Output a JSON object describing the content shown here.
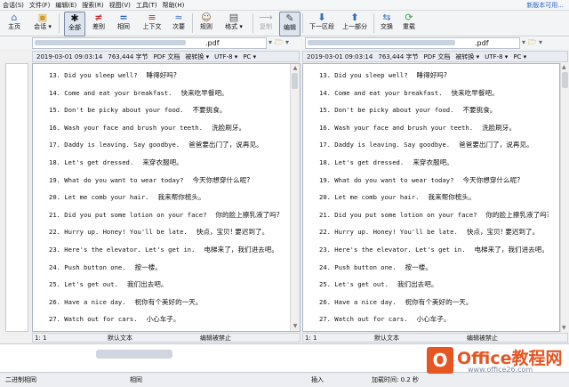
{
  "menu": [
    "会话(S)",
    "文件(F)",
    "编辑(E)",
    "搜索(R)",
    "视图(V)",
    "工具(T)",
    "帮助(H)"
  ],
  "menu_right": "新版本可用...",
  "toolbar": {
    "home": "主页",
    "session": "会话",
    "all": "全部",
    "diffs": "差别",
    "same": "相同",
    "context": "上下文",
    "minor": "次要",
    "rules": "规则",
    "format": "格式",
    "copy": "复制",
    "edit": "编辑",
    "next_section": "下一区段",
    "prev_section": "上一部分",
    "swap": "交换",
    "reload": "重载"
  },
  "left": {
    "ext": ".pdf",
    "info": [
      "2019-03-01 09:03:14",
      "763,444 字节",
      "PDF 文档",
      "被转换",
      "UTF-8",
      "PC"
    ]
  },
  "right": {
    "ext": ".pdf",
    "info": [
      "2019-03-01 09:03:14",
      "763,444 字节",
      "PDF 文档",
      "被转换",
      "UTF-8",
      "PC"
    ]
  },
  "lines": [
    {
      "en": "13. Did you sleep well?",
      "zh": "睡得好吗?"
    },
    {
      "en": "14. Come and eat your breakfast.",
      "zh": "快来吃早餐吧。"
    },
    {
      "en": "15. Don't be picky about your food.",
      "zh": "不要挑食。"
    },
    {
      "en": "16. Wash your face and brush your teeth.",
      "zh": "洗脸刷牙。"
    },
    {
      "en": "17. Daddy is leaving. Say goodbye.",
      "zh": "爸爸要出门了，说再见。"
    },
    {
      "en": "18. Let's get dressed.",
      "zh": "来穿衣服吧。"
    },
    {
      "en": "19. What do you want to wear today?",
      "zh": "今天你想穿什么呢?"
    },
    {
      "en": "20. Let me comb your hair.",
      "zh": "我来帮你梳头。"
    },
    {
      "en": "21. Did you put some lotion on your face?",
      "zh": "你的脸上擦乳液了吗?"
    },
    {
      "en": "22. Hurry up. Honey! You'll be late.",
      "zh": "快点，宝贝! 要迟到了。"
    },
    {
      "en": "23. Here's the elevator. Let's get in.",
      "zh": "电梯来了，我们进去吧。"
    },
    {
      "en": "24. Push button one.",
      "zh": "按一楼。"
    },
    {
      "en": "25. Let's get out.",
      "zh": "我们出去吧。"
    },
    {
      "en": "26. Have a nice day.",
      "zh": "祝你有个美好的一天。"
    },
    {
      "en": "27. Watch out for cars.",
      "zh": "小心车子。"
    }
  ],
  "pane_status": {
    "pos": "1: 1",
    "default_text": "默认文本",
    "edit_disabled": "编辑被禁止"
  },
  "statusbar": {
    "binary_same": "二进制相同",
    "same": "相同",
    "insert": "插入",
    "load_time": "加载时间: 0.2 秒"
  },
  "logo": {
    "letter": "O",
    "text": "Office教程网",
    "url": "www.office26.com"
  }
}
